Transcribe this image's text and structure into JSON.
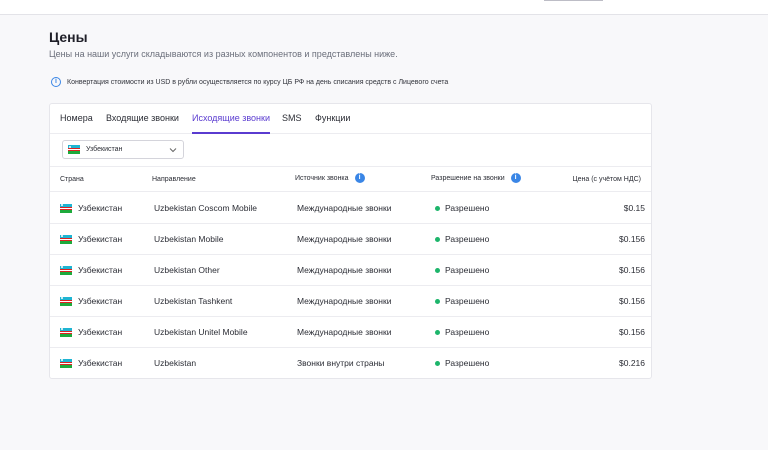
{
  "page": {
    "title": "Цены",
    "subtitle": "Цены на наши услуги складываются из разных компонентов и представлены ниже.",
    "notice": "Конвертация стоимости из USD в рубли осуществляется по курсу ЦБ РФ на день списания средств с Лицевого счета"
  },
  "tabs": [
    {
      "label": "Номера",
      "active": false
    },
    {
      "label": "Входящие звонки",
      "active": false
    },
    {
      "label": "Исходящие звонки",
      "active": true
    },
    {
      "label": "SMS",
      "active": false
    },
    {
      "label": "Функции",
      "active": false
    }
  ],
  "country_select": {
    "value": "Узбекистан"
  },
  "table": {
    "headers": [
      "Страна",
      "Направление",
      "Источник звонка",
      "Разрешение на звонки",
      "Цена (с учётом НДС)"
    ],
    "rows": [
      {
        "country": "Узбекистан",
        "direction": "Uzbekistan Coscom Mobile",
        "source": "Международные звонки",
        "permission": "Разрешено",
        "price": "$0.15"
      },
      {
        "country": "Узбекистан",
        "direction": "Uzbekistan Mobile",
        "source": "Международные звонки",
        "permission": "Разрешено",
        "price": "$0.156"
      },
      {
        "country": "Узбекистан",
        "direction": "Uzbekistan Other",
        "source": "Международные звонки",
        "permission": "Разрешено",
        "price": "$0.156"
      },
      {
        "country": "Узбекистан",
        "direction": "Uzbekistan Tashkent",
        "source": "Международные звонки",
        "permission": "Разрешено",
        "price": "$0.156"
      },
      {
        "country": "Узбекистан",
        "direction": "Uzbekistan Unitel Mobile",
        "source": "Международные звонки",
        "permission": "Разрешено",
        "price": "$0.156"
      },
      {
        "country": "Узбекистан",
        "direction": "Uzbekistan",
        "source": "Звонки внутри страны",
        "permission": "Разрешено",
        "price": "$0.216"
      }
    ]
  },
  "colors": {
    "accent": "#5a3bd0",
    "info": "#3a86e6",
    "allowed": "#1db56b"
  },
  "icons": {
    "notice": "info-circle-icon",
    "header_info": "info-icon",
    "select": "chevron-down-icon",
    "flag": "uzbekistan-flag-icon"
  }
}
